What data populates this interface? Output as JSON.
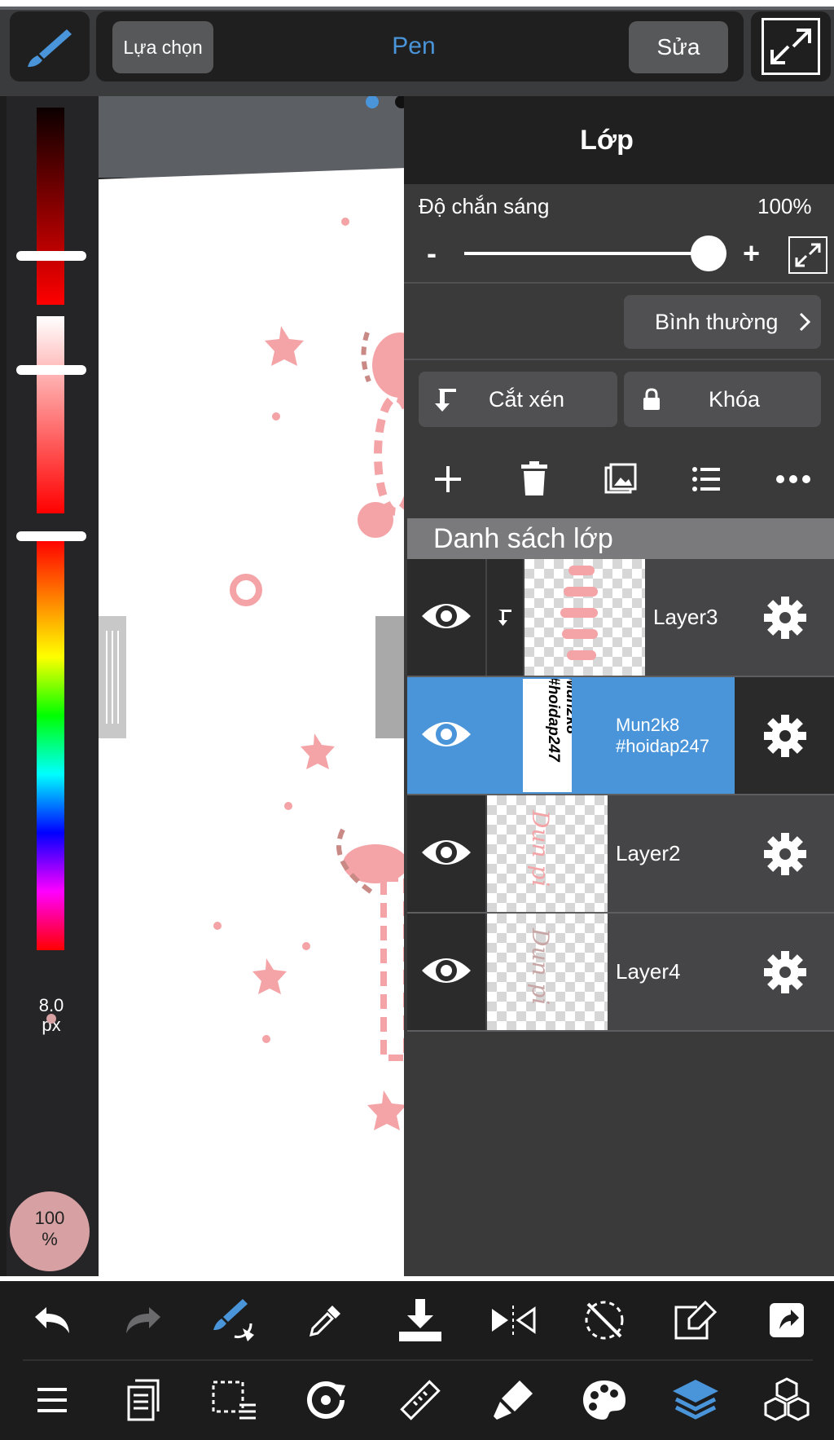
{
  "toolbar": {
    "selection_label": "Lựa chọn",
    "tool_name": "Pen",
    "edit_label": "Sửa"
  },
  "leftbar": {
    "brush_size": "8.0",
    "brush_unit": "px",
    "opacity": "100",
    "opacity_unit": "%"
  },
  "layers_panel": {
    "title": "Lớp",
    "opacity_label": "Độ chắn sáng",
    "opacity_value": "100%",
    "minus": "-",
    "plus": "+",
    "blend_mode": "Bình thường",
    "clip_label": "Cắt xén",
    "lock_label": "Khóa",
    "list_title": "Danh sách lớp",
    "layers": [
      {
        "name": "Layer3",
        "selected": false,
        "clipped": true
      },
      {
        "name": "Mun2k8\n#hoidap247",
        "selected": true,
        "clipped": false
      },
      {
        "name": "Layer2",
        "selected": false,
        "clipped": false
      },
      {
        "name": "Layer4",
        "selected": false,
        "clipped": false
      }
    ],
    "thumb_text_selected": "Mun2k8\n#hoidap247",
    "thumb_script_layer2": "Dun pi",
    "thumb_script_layer4": "Dun pi"
  },
  "colors": {
    "accent_blue": "#4a95d9",
    "pink": "#f4a3a6",
    "dark_pink": "#c98a86"
  },
  "icons": {
    "top": [
      "brush-icon",
      "fullscreen-icon"
    ],
    "panel": [
      "add-layer-icon",
      "trash-icon",
      "image-icon",
      "list-icon",
      "more-icon"
    ],
    "bottom_row1": [
      "undo-icon",
      "redo-icon",
      "brush-swap-icon",
      "eyedropper-icon",
      "save-download-icon",
      "flip-icon",
      "rotate-off-icon",
      "edit-frame-icon",
      "share-icon"
    ],
    "bottom_row2": [
      "menu-icon",
      "pages-icon",
      "selection-icon",
      "transform-icon",
      "ruler-icon",
      "fill-icon",
      "palette-icon",
      "layers-icon",
      "materials-icon"
    ]
  }
}
